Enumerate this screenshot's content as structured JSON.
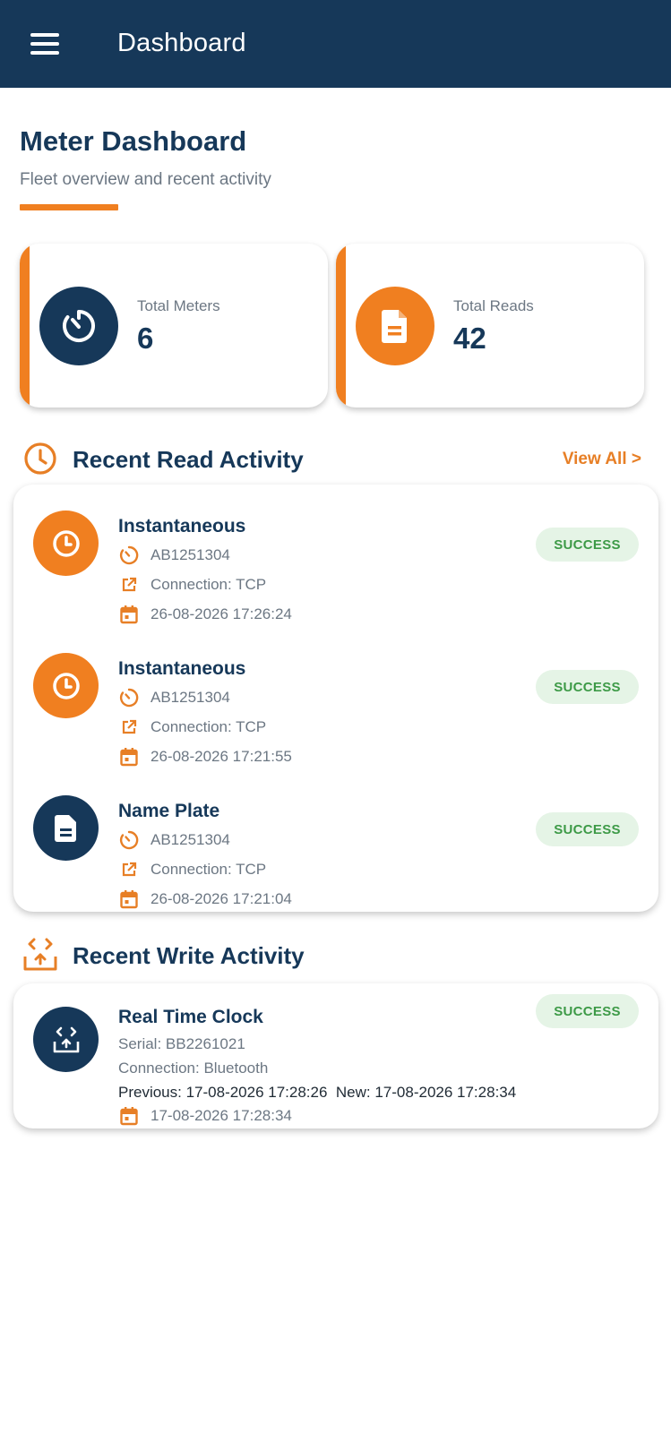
{
  "appbar": {
    "title": "Dashboard"
  },
  "header": {
    "title": "Meter Dashboard",
    "subtitle": "Fleet overview and recent activity"
  },
  "stats": [
    {
      "label": "Total Meters",
      "value": "6",
      "icon": "meter-gauge-icon",
      "color": "#163859"
    },
    {
      "label": "Total Reads",
      "value": "42",
      "icon": "document-icon",
      "color": "#f07f20"
    }
  ],
  "read_section": {
    "title": "Recent Read Activity",
    "view_all": "View All >",
    "items": [
      {
        "title": "Instantaneous",
        "meter": "AB1251304",
        "connection": "Connection: TCP",
        "timestamp": "26-08-2026 17:26:24",
        "status": "SUCCESS",
        "icon": "clock-icon"
      },
      {
        "title": "Instantaneous",
        "meter": "AB1251304",
        "connection": "Connection: TCP",
        "timestamp": "26-08-2026 17:21:55",
        "status": "SUCCESS",
        "icon": "clock-icon"
      },
      {
        "title": "Name Plate",
        "meter": "AB1251304",
        "connection": "Connection: TCP",
        "timestamp": "26-08-2026 17:21:04",
        "status": "SUCCESS",
        "icon": "document-icon"
      }
    ]
  },
  "write_section": {
    "title": "Recent Write Activity",
    "items": [
      {
        "title": "Real Time Clock",
        "serial": "Serial: BB2261021",
        "connection": "Connection: Bluetooth",
        "change": "Previous: 17-08-2026 17:28:26  New: 17-08-2026 17:28:34",
        "timestamp": "17-08-2026 17:28:34",
        "status": "SUCCESS",
        "icon": "code-upload-icon"
      }
    ]
  },
  "colors": {
    "navy": "#163859",
    "orange": "#f07f20",
    "success_bg": "#e5f4e6",
    "success_text": "#3d9a47"
  }
}
